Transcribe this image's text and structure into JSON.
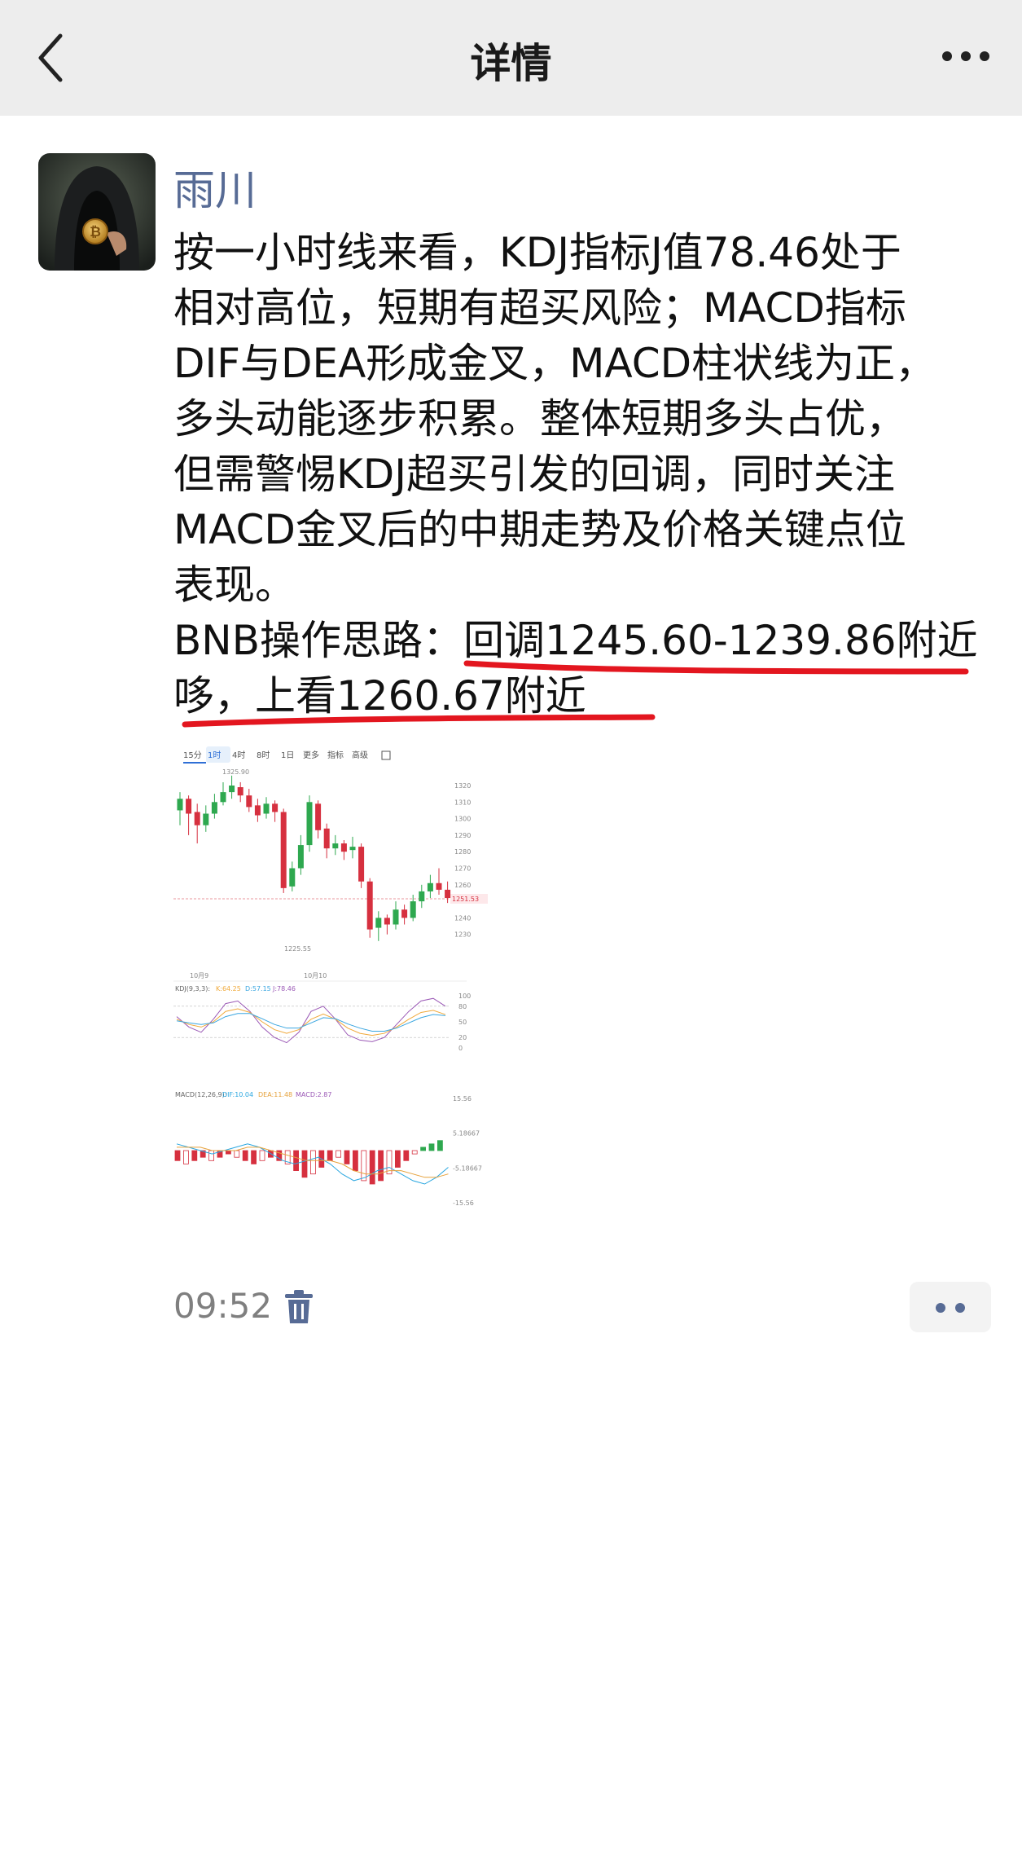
{
  "header": {
    "title": "详情"
  },
  "post": {
    "author": "雨川",
    "lines": [
      "按一小时线来看，KDJ指标J值78.46处于",
      "相对高位，短期有超买风险；MACD指标",
      "DIF与DEA形成金叉，MACD柱状线为正，",
      "多头动能逐步积累。整体短期多头占优，",
      "但需警惕KDJ超买引发的回调，同时关注",
      "MACD金叉后的中期走势及价格关键点位",
      "表现。",
      "BNB操作思路：回调1245.60-1239.86附近",
      "哆，上看1260.67附近"
    ],
    "time": "09:52"
  },
  "chart": {
    "tabs": [
      "15分",
      "1时",
      "4时",
      "8时",
      "1日",
      "更多",
      "指标",
      "高级"
    ],
    "active_tab": "1时",
    "price_ticks": [
      "1320",
      "1310",
      "1300",
      "1290",
      "1280",
      "1270",
      "1260",
      "1250",
      "1240",
      "1230"
    ],
    "current_price": "1251.53",
    "high_label": "1325.90",
    "low_label": "1225.55",
    "date_labels": [
      "10月9",
      "10月10"
    ],
    "kdj_label": "KDJ(9,3,3):",
    "kdj_values": [
      "K:64.25",
      "D:57.15",
      "J:78.46"
    ],
    "kdj_ticks": [
      "100",
      "80",
      "50",
      "20",
      "0"
    ],
    "macd_label": "MACD(12,26,9):",
    "macd_values": [
      "DIF:10.04",
      "DEA:11.48",
      "MACD:2.87"
    ],
    "macd_ticks": [
      "15.56",
      "5.18667",
      "-5.18667",
      "-15.56"
    ],
    "colors": {
      "up": "#2ea84f",
      "down": "#d6303f",
      "k": "#f0a93a",
      "d": "#3aa6e0",
      "j": "#9b59b6",
      "dif": "#2aa7e0",
      "dea": "#e6a23c",
      "accent": "#576b95",
      "ink": "#e3161f"
    }
  }
}
